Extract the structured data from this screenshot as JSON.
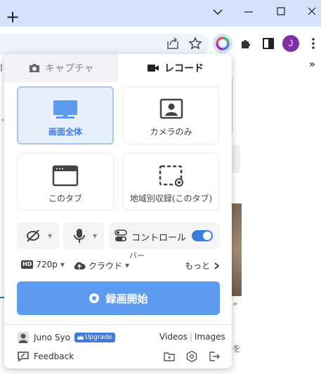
{
  "browser": {
    "new_tab_glyph": "+",
    "avatar_letter": "J",
    "bookmarks_overflow": "»",
    "page_fragments": [
      "l",
      "。",
      "”",
      "を"
    ]
  },
  "tabs": [
    {
      "label": "キャプチャ",
      "icon": "camera-icon",
      "active": false
    },
    {
      "label": "レコード",
      "icon": "video-icon",
      "active": true
    }
  ],
  "modes": [
    {
      "label": "画面全体",
      "icon": "monitor-icon",
      "selected": true
    },
    {
      "label": "カメラのみ",
      "icon": "camera-portrait-icon",
      "selected": false
    },
    {
      "label": "このタブ",
      "icon": "browser-tab-icon",
      "selected": false
    },
    {
      "label": "地域別収録(このタブ)",
      "icon": "region-select-icon",
      "selected": false
    }
  ],
  "controls": {
    "camera_icon": "camera-off-icon",
    "mic_icon": "microphone-icon",
    "control_bar_label": "コントロール",
    "control_bar_overflow": "バー",
    "control_bar_enabled": true
  },
  "options": {
    "quality_badge": "HD",
    "quality": "720p",
    "storage": "クラウド",
    "more": "もっと"
  },
  "start_button": {
    "label": "録画開始"
  },
  "account": {
    "user_name": "Juno Syo",
    "upgrade_label": "Upgrade",
    "videos_link": "Videos",
    "separator": "|",
    "images_link": "Images",
    "feedback_label": "Feedback"
  },
  "colors": {
    "accent": "#3d7be0",
    "start_button": "#5e9aef",
    "selected_card": "#e7f0fc",
    "chrome_titlebar": "#d3e3fd"
  }
}
